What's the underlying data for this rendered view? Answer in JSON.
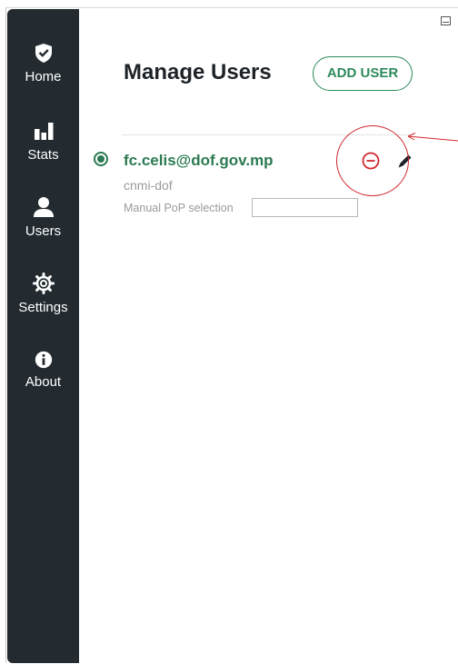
{
  "sidebar": {
    "items": [
      {
        "label": "Home",
        "icon": "shield-check-icon"
      },
      {
        "label": "Stats",
        "icon": "bar-chart-icon"
      },
      {
        "label": "Users",
        "icon": "user-icon"
      },
      {
        "label": "Settings",
        "icon": "gear-icon"
      },
      {
        "label": "About",
        "icon": "info-icon"
      }
    ]
  },
  "main": {
    "title": "Manage Users",
    "add_user_label": "ADD USER",
    "user": {
      "email": "fc.celis@dof.gov.mp",
      "org": "cnmi-dof",
      "pop_label": "Manual PoP selection",
      "pop_value": ""
    }
  },
  "colors": {
    "sidebar_bg": "#232b30",
    "accent_green": "#2c7a51",
    "remove_red": "#d2272d"
  }
}
